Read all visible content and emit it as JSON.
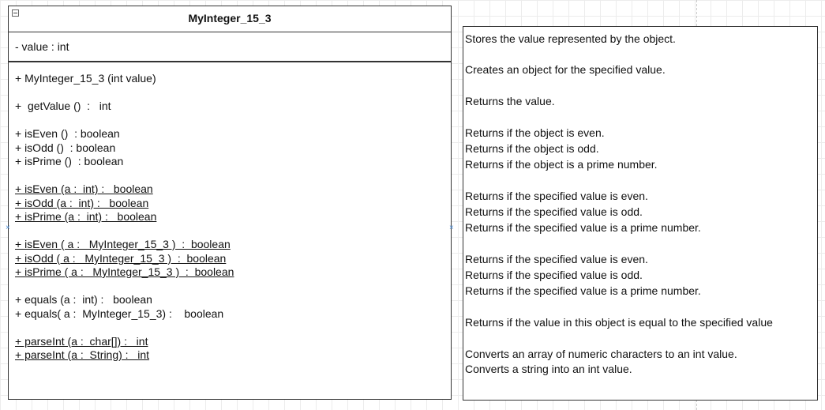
{
  "class_box": {
    "name": "MyInteger_15_3",
    "attribute": "-  value :   int",
    "operations": [
      "+ MyInteger_15_3 (int value)",
      "+  getValue ()  :   int",
      "+ isEven ()  : boolean",
      "+ isOdd ()  : boolean",
      "+ isPrime ()  : boolean",
      "+ isEven (a :  int) :   boolean",
      "+ isOdd (a :  int) :   boolean",
      "+ isPrime (a :  int) :   boolean",
      "+ isEven ( a :   MyInteger_15_3 )  :  boolean",
      "+ isOdd ( a :   MyInteger_15_3 )  :  boolean",
      "+ isPrime ( a :   MyInteger_15_3 )  :  boolean",
      "+ equals (a :  int) :   boolean",
      "+ equals( a :  MyInteger_15_3) :    boolean",
      "+ parseInt (a :  char[]) :   int",
      "+ parseInt (a :  String) :   int"
    ]
  },
  "descriptions": [
    "Stores the value represented by the object.",
    "Creates an object for the specified value.",
    "Returns the value.",
    "Returns if the object is even.",
    "Returns if the object is odd.",
    "Returns if the object is a prime number.",
    "Returns if the specified value is even.",
    "Returns if the specified value is odd.",
    "Returns if the specified value is a prime number.",
    "Returns if the specified value is even.",
    "Returns if the specified value is odd.",
    "Returns if the specified value is a prime number.",
    "Returns if the value in this object is equal to the specified value",
    "Converts an array of numeric characters to an int value.",
    "Converts a string into an int value."
  ],
  "icons": {
    "collapse": "minus-square-icon",
    "connection_marker": "x-marker-icon",
    "marker_glyph": "×"
  }
}
